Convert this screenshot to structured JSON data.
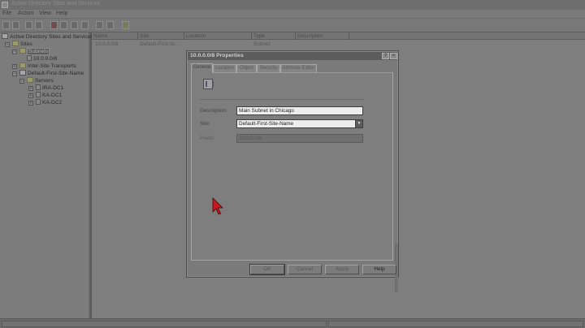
{
  "window": {
    "title": "Active Directory Sites and Services"
  },
  "menu": [
    {
      "label": "File",
      "x": 3
    },
    {
      "label": "Action",
      "x": 22
    },
    {
      "label": "View",
      "x": 48
    },
    {
      "label": "Help",
      "x": 69
    }
  ],
  "tree": {
    "root": "Active Directory Sites and Services",
    "sites": "Sites",
    "subnets": "Subnets",
    "subnet_item": "10.0.0.0/8",
    "inter_site": "Inter-Site Transports",
    "default_site": "Default-First-Site-Name",
    "servers": "Servers",
    "server_list": [
      "IRA-DC1",
      "KA-DC1",
      "KA-DC2"
    ]
  },
  "list": {
    "columns": [
      "Name",
      "Site",
      "Location",
      "Type",
      "Description"
    ],
    "rows": [
      {
        "name": "10.0.0.0/8",
        "site": "Default-First-Si...",
        "type": "Subnet"
      }
    ]
  },
  "dialog": {
    "title": "10.0.0.0/8 Properties",
    "tabs": [
      "General",
      "Location",
      "Object",
      "Security",
      "Attribute Editor"
    ],
    "active_tab": "General",
    "fields": {
      "description_label": "Description:",
      "description_value": "Main Subnet in Chicago",
      "site_label": "Site:",
      "site_value": "Default-First-Site-Name",
      "prefix_label": "Prefix:",
      "prefix_value": "10.0.0.0/8"
    },
    "buttons": {
      "ok": "OK",
      "cancel": "Cancel",
      "apply": "Apply",
      "help": "Help"
    }
  },
  "colors": {
    "cursor": "#c8191e",
    "dialog_title": "#5c5c5c",
    "tree_selection": "#5c5c5c"
  }
}
